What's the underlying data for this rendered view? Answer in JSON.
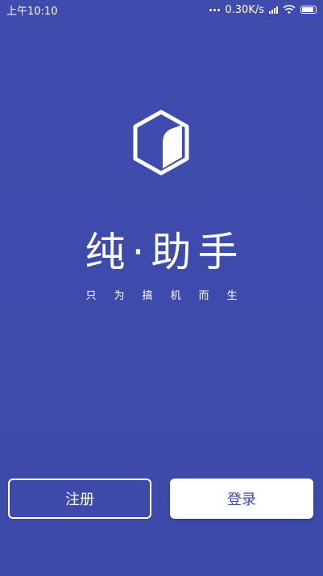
{
  "status_bar": {
    "time": "上午10:10",
    "network_speed": "0.30K/s",
    "battery_level": 0.9
  },
  "app": {
    "title": "纯·助手",
    "subtitle": "只为搞机而生",
    "logo_icon": "cube-logo-icon",
    "background_color": "#3f4dae"
  },
  "actions": {
    "register_label": "注册",
    "login_label": "登录"
  }
}
